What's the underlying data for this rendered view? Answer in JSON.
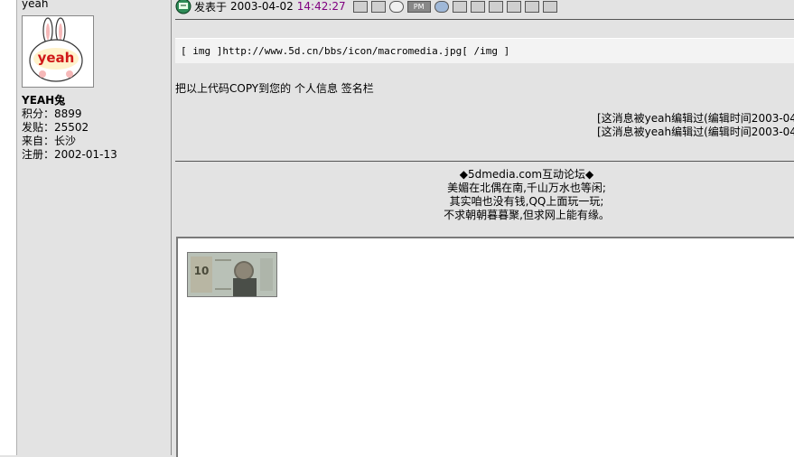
{
  "user": {
    "top_name": "yeah",
    "name": "YEAH兔",
    "avatar_text": "yeah",
    "stats": [
      "积分：8899",
      "发贴：25502",
      "来自：长沙",
      "注册：2002-01-13"
    ]
  },
  "post": {
    "posted_label": "发表于",
    "date": "2003-04-02",
    "time": "14:42:27",
    "pm_label": "PM",
    "code": "[ img ]http://www.5d.cn/bbs/icon/macromedia.jpg[ /img ]",
    "line": "把以上代码COPY到您的 个人信息 签名栏",
    "edit_notes": [
      "[这消息被yeah编辑过(编辑时间2003-04-",
      "[这消息被yeah编辑过(编辑时间2003-04-"
    ]
  },
  "signature": {
    "lines": [
      "◆5dmedia.com互动论坛◆",
      "美媚在北偶在南,千山万水也等闲;",
      "其实咱也没有钱,QQ上面玩一玩;",
      "不求朝朝暮暮聚,但求网上能有缘。"
    ]
  },
  "colors": {
    "time": "#800080"
  }
}
